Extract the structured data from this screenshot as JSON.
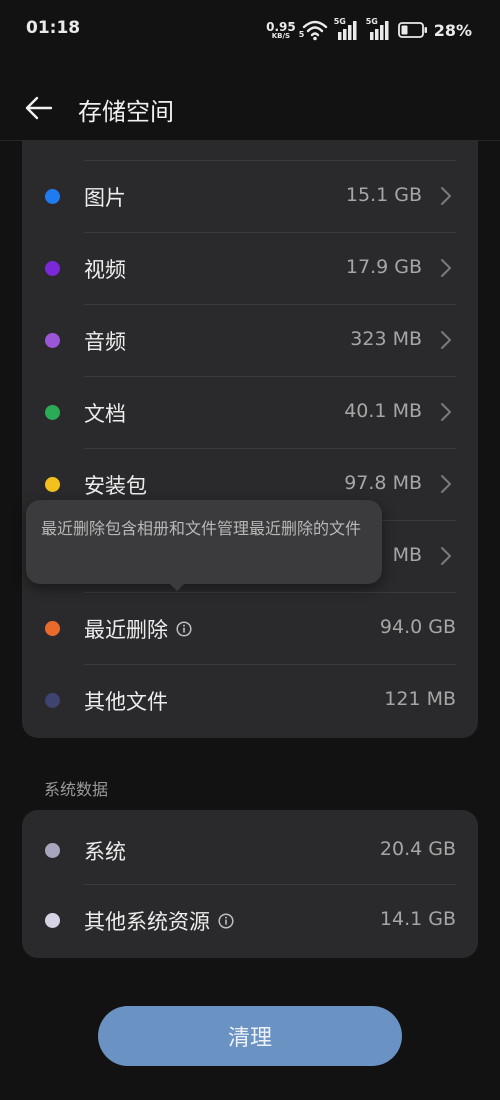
{
  "status_bar": {
    "time": "01:18",
    "net_speed": "0.95",
    "net_unit": "KB/S",
    "wifi_badge": "5",
    "sim1_badge": "5G",
    "sim2_badge": "5G",
    "battery_percent": "28%"
  },
  "header": {
    "title": "存储空间"
  },
  "media_items": [
    {
      "label": "图片",
      "value": "15.1 GB",
      "color": "#1e7bf0"
    },
    {
      "label": "视频",
      "value": "17.9 GB",
      "color": "#7a28d8"
    },
    {
      "label": "音频",
      "value": "323 MB",
      "color": "#9b55d9"
    },
    {
      "label": "文档",
      "value": "40.1 MB",
      "color": "#2bab55"
    },
    {
      "label": "安装包",
      "value": "97.8 MB",
      "color": "#f2c11d"
    },
    {
      "label": "",
      "value": "MB",
      "color": "#3b9be0"
    },
    {
      "label": "最近删除",
      "value": "94.0 GB",
      "color": "#ea6a2b"
    },
    {
      "label": "其他文件",
      "value": "121 MB",
      "color": "#3e4370"
    }
  ],
  "tooltip": {
    "text": "最近删除包含相册和文件管理最近删除的文件"
  },
  "system_section": {
    "title": "系统数据",
    "items": [
      {
        "label": "系统",
        "value": "20.4 GB",
        "color": "#a7a6bd"
      },
      {
        "label": "其他系统资源",
        "value": "14.1 GB",
        "color": "#d6d4e4"
      }
    ]
  },
  "actions": {
    "clean_label": "清理"
  },
  "colors": {
    "accent_button": "#6a93c4",
    "card_bg": "#2a2a2c",
    "page_bg": "#121212"
  }
}
